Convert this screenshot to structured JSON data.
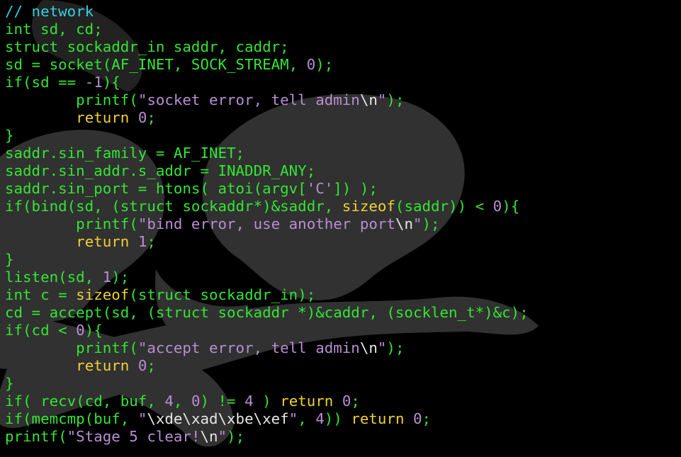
{
  "code": {
    "lines": [
      [
        {
          "t": "// network",
          "c": "c"
        }
      ],
      [
        {
          "t": "int sd, cd;",
          "c": "g"
        }
      ],
      [
        {
          "t": "struct sockaddr_in saddr, caddr;",
          "c": "g"
        }
      ],
      [
        {
          "t": "sd = socket(AF_INET, SOCK_STREAM, ",
          "c": "g"
        },
        {
          "t": "0",
          "c": "p"
        },
        {
          "t": ");",
          "c": "g"
        }
      ],
      [
        {
          "t": "if(sd == ",
          "c": "g"
        },
        {
          "t": "-1",
          "c": "p"
        },
        {
          "t": "){",
          "c": "g"
        }
      ],
      [
        {
          "t": "        printf(",
          "c": "g"
        },
        {
          "t": "\"socket error, tell admin",
          "c": "p"
        },
        {
          "t": "\\n",
          "c": "w"
        },
        {
          "t": "\"",
          "c": "p"
        },
        {
          "t": ");",
          "c": "g"
        }
      ],
      [
        {
          "t": "        ",
          "c": "g"
        },
        {
          "t": "return",
          "c": "y"
        },
        {
          "t": " ",
          "c": "g"
        },
        {
          "t": "0",
          "c": "p"
        },
        {
          "t": ";",
          "c": "g"
        }
      ],
      [
        {
          "t": "}",
          "c": "g"
        }
      ],
      [
        {
          "t": "saddr.sin_family = AF_INET;",
          "c": "g"
        }
      ],
      [
        {
          "t": "saddr.sin_addr.s_addr = INADDR_ANY;",
          "c": "g"
        }
      ],
      [
        {
          "t": "saddr.sin_port = htons( atoi(argv[",
          "c": "g"
        },
        {
          "t": "'C'",
          "c": "p"
        },
        {
          "t": "]) );",
          "c": "g"
        }
      ],
      [
        {
          "t": "if(bind(sd, (struct sockaddr*)&saddr, ",
          "c": "g"
        },
        {
          "t": "sizeof",
          "c": "y"
        },
        {
          "t": "(saddr)) < ",
          "c": "g"
        },
        {
          "t": "0",
          "c": "p"
        },
        {
          "t": "){",
          "c": "g"
        }
      ],
      [
        {
          "t": "        printf(",
          "c": "g"
        },
        {
          "t": "\"bind error, use another port",
          "c": "p"
        },
        {
          "t": "\\n",
          "c": "w"
        },
        {
          "t": "\"",
          "c": "p"
        },
        {
          "t": ");",
          "c": "g"
        }
      ],
      [
        {
          "t": "        ",
          "c": "g"
        },
        {
          "t": "return",
          "c": "y"
        },
        {
          "t": " ",
          "c": "g"
        },
        {
          "t": "1",
          "c": "p"
        },
        {
          "t": ";",
          "c": "g"
        }
      ],
      [
        {
          "t": "}",
          "c": "g"
        }
      ],
      [
        {
          "t": "listen(sd, ",
          "c": "g"
        },
        {
          "t": "1",
          "c": "p"
        },
        {
          "t": ");",
          "c": "g"
        }
      ],
      [
        {
          "t": "int c = ",
          "c": "g"
        },
        {
          "t": "sizeof",
          "c": "y"
        },
        {
          "t": "(struct sockaddr_in);",
          "c": "g"
        }
      ],
      [
        {
          "t": "cd = accept(sd, (struct sockaddr *)&caddr, (socklen_t*)&c);",
          "c": "g"
        }
      ],
      [
        {
          "t": "if(cd < ",
          "c": "g"
        },
        {
          "t": "0",
          "c": "p"
        },
        {
          "t": "){",
          "c": "g"
        }
      ],
      [
        {
          "t": "        printf(",
          "c": "g"
        },
        {
          "t": "\"accept error, tell admin",
          "c": "p"
        },
        {
          "t": "\\n",
          "c": "w"
        },
        {
          "t": "\"",
          "c": "p"
        },
        {
          "t": ");",
          "c": "g"
        }
      ],
      [
        {
          "t": "        ",
          "c": "g"
        },
        {
          "t": "return",
          "c": "y"
        },
        {
          "t": " ",
          "c": "g"
        },
        {
          "t": "0",
          "c": "p"
        },
        {
          "t": ";",
          "c": "g"
        }
      ],
      [
        {
          "t": "}",
          "c": "g"
        }
      ],
      [
        {
          "t": "if( recv(cd, buf, ",
          "c": "g"
        },
        {
          "t": "4",
          "c": "p"
        },
        {
          "t": ", ",
          "c": "g"
        },
        {
          "t": "0",
          "c": "p"
        },
        {
          "t": ") != ",
          "c": "g"
        },
        {
          "t": "4",
          "c": "p"
        },
        {
          "t": " ) ",
          "c": "g"
        },
        {
          "t": "return",
          "c": "y"
        },
        {
          "t": " ",
          "c": "g"
        },
        {
          "t": "0",
          "c": "p"
        },
        {
          "t": ";",
          "c": "g"
        }
      ],
      [
        {
          "t": "if(memcmp(buf, ",
          "c": "g"
        },
        {
          "t": "\"",
          "c": "p"
        },
        {
          "t": "\\xde\\xad\\xbe\\xef",
          "c": "w"
        },
        {
          "t": "\"",
          "c": "p"
        },
        {
          "t": ", ",
          "c": "g"
        },
        {
          "t": "4",
          "c": "p"
        },
        {
          "t": ")) ",
          "c": "g"
        },
        {
          "t": "return",
          "c": "y"
        },
        {
          "t": " ",
          "c": "g"
        },
        {
          "t": "0",
          "c": "p"
        },
        {
          "t": ";",
          "c": "g"
        }
      ],
      [
        {
          "t": "printf(",
          "c": "g"
        },
        {
          "t": "\"Stage 5 clear!",
          "c": "p"
        },
        {
          "t": "\\n",
          "c": "w"
        },
        {
          "t": "\"",
          "c": "p"
        },
        {
          "t": ");",
          "c": "g"
        }
      ]
    ]
  },
  "colors": {
    "background": "#000000",
    "code": "#33e533",
    "comment": "#33d0e0",
    "keyword": "#f0d034",
    "literal": "#b98ed3",
    "escape": "#e6e6e6",
    "watermark": "#3a3a3a"
  },
  "icons": {
    "watermark": "skull-and-crossbones-watermark"
  }
}
